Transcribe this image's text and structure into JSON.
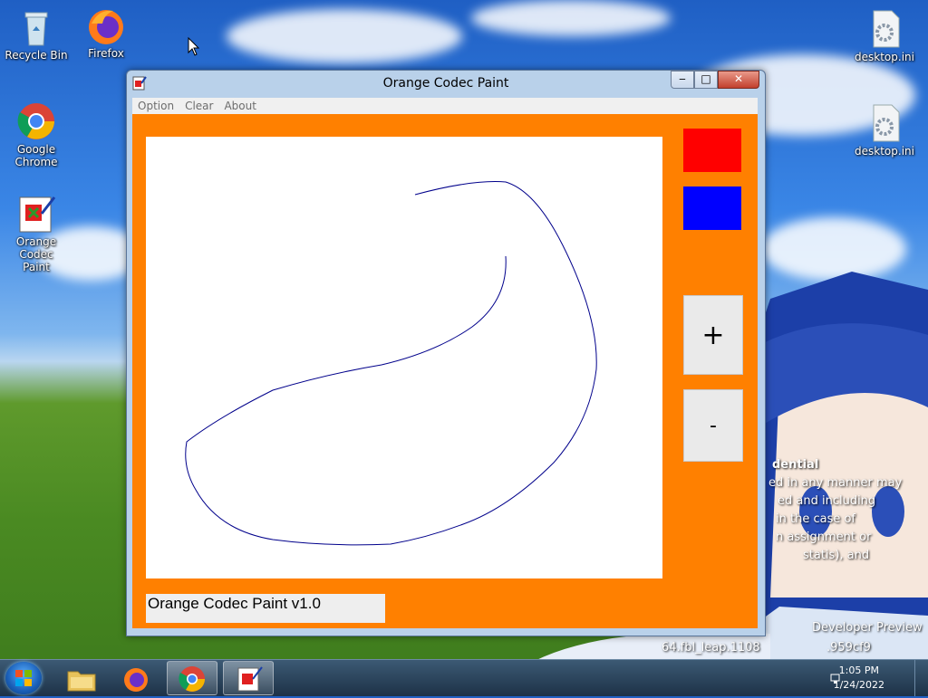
{
  "desktop": {
    "icons": [
      {
        "label": "Recycle Bin",
        "icon": "recycle-bin-icon"
      },
      {
        "label": "Firefox",
        "icon": "firefox-icon"
      },
      {
        "label": "Google Chrome",
        "icon": "chrome-icon"
      },
      {
        "label": "Orange Codec Paint",
        "icon": "paint-app-icon"
      },
      {
        "label": "desktop.ini",
        "icon": "settings-file-icon"
      },
      {
        "label": "desktop.ini",
        "icon": "settings-file-icon"
      }
    ],
    "wallpaper_text": {
      "line1": "dential",
      "line2": "ed in any manner may",
      "line3": "ed and including",
      "line4": "in the case of",
      "line5": "n assignment or",
      "line6": "statis), and",
      "line7": "Developer Preview",
      "line8": "64.fbl_leap.1108",
      "line9": ".959cf9"
    }
  },
  "window": {
    "title": "Orange Codec Paint",
    "buttons": {
      "minimize": "‒",
      "maximize": "□",
      "close": "✕"
    },
    "menu": [
      "Option",
      "Clear",
      "About"
    ],
    "colors": {
      "client_bg": "#ff8000",
      "swatch_1": "#ff0000",
      "swatch_2": "#0000ff",
      "stroke": "#00008b"
    },
    "zoom_in_label": "+",
    "zoom_out_label": "-",
    "status_text": "Orange Codec Paint v1.0"
  },
  "taskbar": {
    "items": [
      "start-orb-icon",
      "file-explorer-icon",
      "firefox-icon",
      "chrome-icon",
      "paint-app-icon"
    ],
    "clock_time": "1:05 PM",
    "clock_date": "1/24/2022"
  }
}
